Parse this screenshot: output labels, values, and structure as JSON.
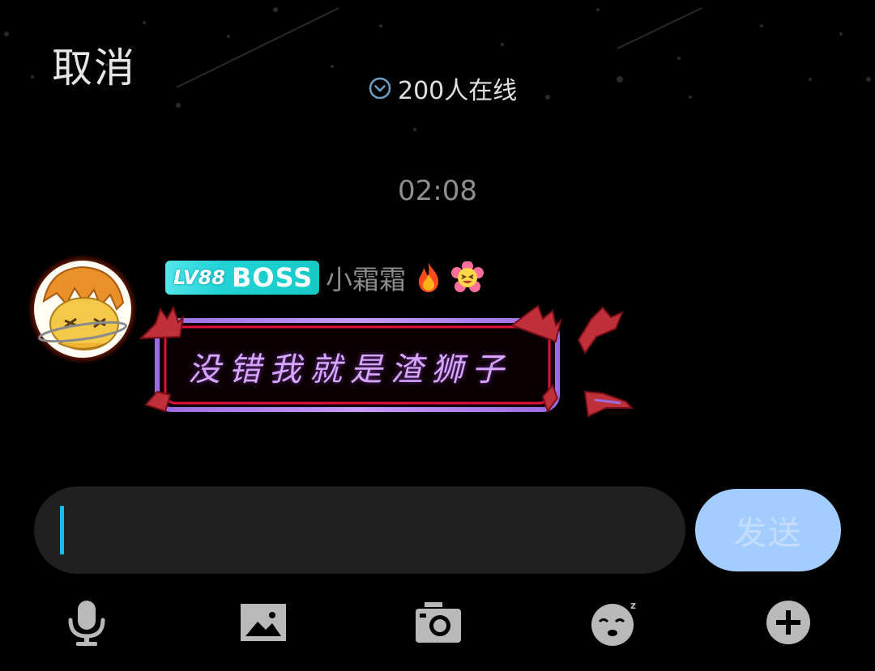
{
  "header": {
    "cancel_label": "取消",
    "online_count_text": "200人在线"
  },
  "chat": {
    "timestamp": "02:08",
    "messages": [
      {
        "sender": {
          "level_badge": "LV88",
          "title_badge": "BOSS",
          "name": "小霜霜",
          "status_icons": [
            "fire-icon",
            "flower-face-icon"
          ]
        },
        "text": "没错我就是渣狮子"
      }
    ]
  },
  "composer": {
    "input_value": "",
    "send_label": "发送"
  },
  "toolbar": {
    "icons": [
      "microphone-icon",
      "image-icon",
      "camera-icon",
      "sleepy-emoji-icon",
      "plus-icon"
    ]
  },
  "colors": {
    "background": "#000000",
    "badge_accent": "#22d3d6",
    "send_button": "#a4cdff",
    "caret": "#19b8f0",
    "bubble_text": "#d8a6ff",
    "toolbar_icon": "#b9b9b9"
  }
}
